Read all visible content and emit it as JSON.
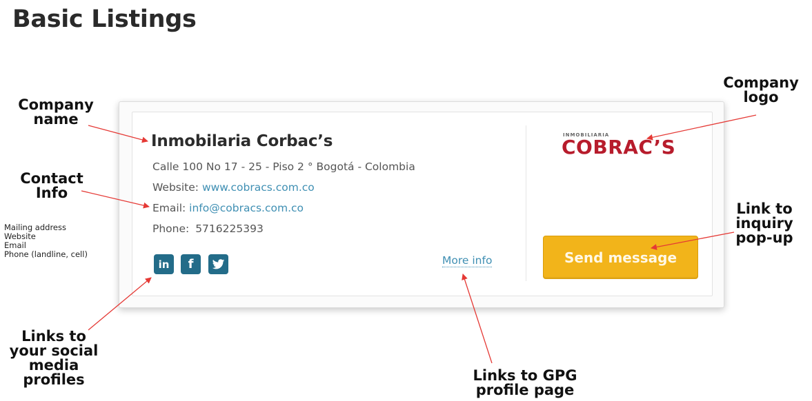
{
  "title": "Basic Listings",
  "callouts": {
    "company_name": "Company\nname",
    "contact_info": "Contact\nInfo",
    "contact_items": [
      "Mailing address",
      "Website",
      "Email",
      "Phone (landline, cell)"
    ],
    "company_logo": "Company\nlogo",
    "inquiry": "Link to\ninquiry\npop-up",
    "social": "Links to\nyour social\nmedia\nprofiles",
    "gpg": "Links to GPG\nprofile page"
  },
  "listing": {
    "company_name": "Inmobilaria Corbac’s",
    "address": "Calle 100 No 17 - 25 - Piso 2 ° Bogotá - Colombia",
    "website_label": "Website:",
    "website": "www.cobracs.com.co",
    "email_label": "Email:",
    "email": "info@cobracs.com.co",
    "phone_label": "Phone:",
    "phone": "5716225393",
    "social": [
      {
        "icon": "linkedin-icon",
        "glyph": "in"
      },
      {
        "icon": "facebook-icon",
        "glyph": "f"
      },
      {
        "icon": "twitter-icon",
        "glyph": ""
      }
    ],
    "more_info": "More info",
    "logo_top": "INMOBILIARIA",
    "logo_main": "COBRAC’S",
    "send_button": "Send message"
  },
  "colors": {
    "accent_link": "#3f8fb3",
    "social_bg": "#236c89",
    "button": "#f2b41a",
    "logo": "#b71c2c",
    "arrow": "#e53935"
  }
}
